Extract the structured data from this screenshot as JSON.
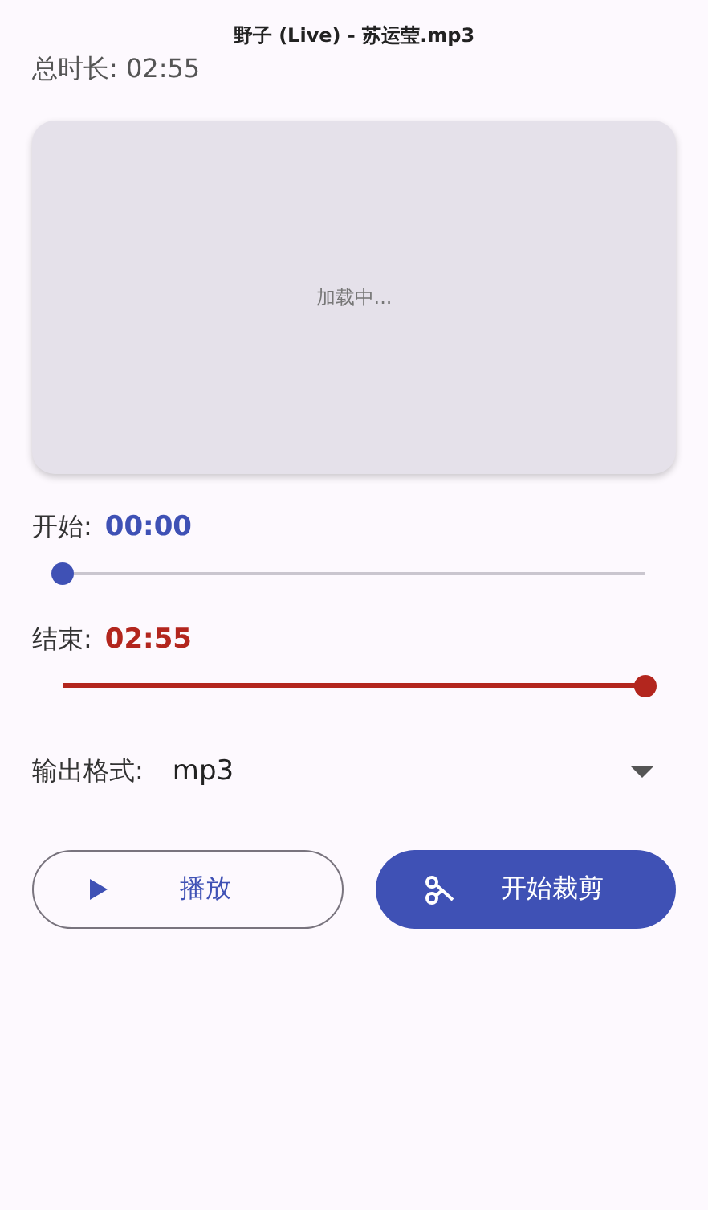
{
  "title": "野子 (Live) - 苏运莹.mp3",
  "total_duration": {
    "label": "总时长:",
    "value": "02:55"
  },
  "waveform": {
    "status": "加载中..."
  },
  "start": {
    "label": "开始:",
    "value": "00:00",
    "level": 0
  },
  "end": {
    "label": "结束:",
    "value": "02:55",
    "level": 1
  },
  "output_format": {
    "label": "输出格式:",
    "value": "mp3"
  },
  "buttons": [
    {
      "kind": "play",
      "label": "播放"
    },
    {
      "kind": "cut",
      "label": "开始裁剪"
    }
  ]
}
